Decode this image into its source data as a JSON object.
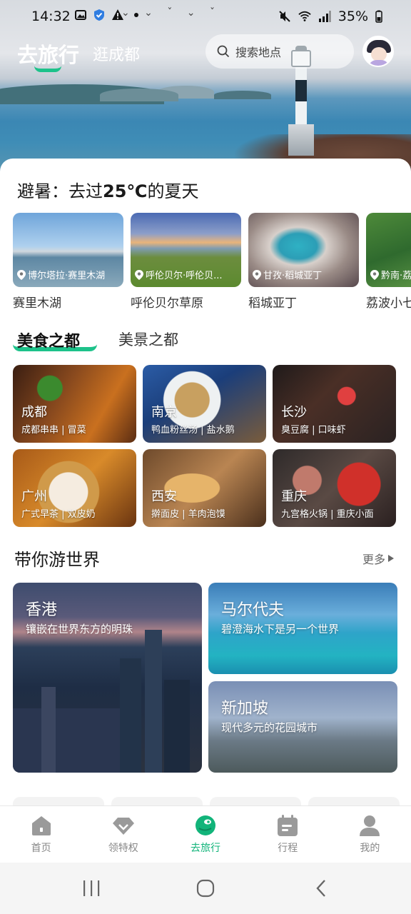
{
  "status_bar": {
    "time": "14:32",
    "battery": "35%"
  },
  "top_nav": {
    "active_tab": "去旅行",
    "other_tab": "逛成都",
    "search_placeholder": "搜索地点"
  },
  "summer": {
    "title_prefix": "避暑：去过",
    "title_bold": "25℃",
    "title_suffix": "的夏天",
    "items": [
      {
        "tag": "博尔塔拉·赛里木湖",
        "name": "赛里木湖"
      },
      {
        "tag": "呼伦贝尔·呼伦贝...",
        "name": "呼伦贝尔草原"
      },
      {
        "tag": "甘孜·稻城亚丁",
        "name": "稻城亚丁"
      },
      {
        "tag": "黔南·荔",
        "name": "荔波小七"
      }
    ]
  },
  "food_tabs": {
    "active": "美食之都",
    "other": "美景之都"
  },
  "food_items": [
    {
      "city": "成都",
      "desc": "成都串串 | 冒菜"
    },
    {
      "city": "南京",
      "desc": "鸭血粉丝汤 | 盐水鹅"
    },
    {
      "city": "长沙",
      "desc": "臭豆腐 | 口味虾"
    },
    {
      "city": "广州",
      "desc": "广式早茶 | 双皮奶"
    },
    {
      "city": "西安",
      "desc": "擀面皮 | 羊肉泡馍"
    },
    {
      "city": "重庆",
      "desc": "九宫格火锅 | 重庆小面"
    }
  ],
  "world": {
    "title": "带你游世界",
    "more": "更多",
    "items": [
      {
        "name": "香港",
        "desc": "镶嵌在世界东方的明珠"
      },
      {
        "name": "马尔代夫",
        "desc": "碧澄海水下是另一个世界"
      },
      {
        "name": "新加坡",
        "desc": "现代多元的花园城市"
      }
    ]
  },
  "tabbar": [
    {
      "label": "首页",
      "icon": "home-icon"
    },
    {
      "label": "领特权",
      "icon": "diamond-icon"
    },
    {
      "label": "去旅行",
      "icon": "travel-planet-icon"
    },
    {
      "label": "行程",
      "icon": "calendar-icon"
    },
    {
      "label": "我的",
      "icon": "person-icon"
    }
  ],
  "colors": {
    "accent": "#1dc28a",
    "tab_active": "#12b47a"
  }
}
